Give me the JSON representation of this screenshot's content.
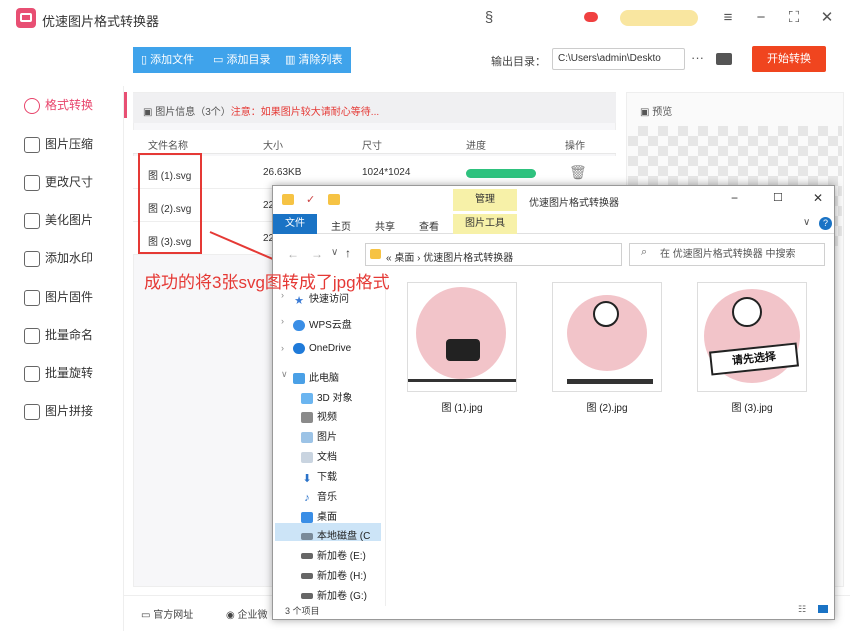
{
  "app": {
    "title": "优速图片格式转换器"
  },
  "toolbar": {
    "add_file": "添加文件",
    "add_dir": "添加目录",
    "clear_list": "清除列表",
    "output_label": "输出目录：",
    "output_path": "C:\\Users\\admin\\Deskto",
    "more": "···",
    "start": "开始转换"
  },
  "sidebar": {
    "items": [
      {
        "label": "格式转换"
      },
      {
        "label": "图片压缩"
      },
      {
        "label": "更改尺寸"
      },
      {
        "label": "美化图片"
      },
      {
        "label": "添加水印"
      },
      {
        "label": "图片固件"
      },
      {
        "label": "批量命名"
      },
      {
        "label": "批量旋转"
      },
      {
        "label": "图片拼接"
      }
    ]
  },
  "list": {
    "info": "图片信息（3个）",
    "note": "注意：如果图片较大请耐心等待...",
    "columns": [
      "文件名称",
      "大小",
      "尺寸",
      "进度",
      "操作"
    ],
    "rows": [
      {
        "name": "图 (1).svg",
        "size": "26.63KB",
        "dim": "1024*1024",
        "progress": 1.0
      },
      {
        "name": "图 (2).svg",
        "size": "22",
        "dim": "",
        "progress": null
      },
      {
        "name": "图 (3).svg",
        "size": "22",
        "dim": "",
        "progress": null
      }
    ]
  },
  "preview": {
    "label": "预览"
  },
  "footer": {
    "website": "官方网址",
    "enterprise": "企业微"
  },
  "explorer": {
    "title": "优速图片格式转换器",
    "manage": "管理",
    "picture_tools": "图片工具",
    "tabs": [
      "文件",
      "主页",
      "共享",
      "查看"
    ],
    "address": "« 桌面 › 优速图片格式转换器",
    "search_placeholder": "在 优速图片格式转换器 中搜索",
    "nav": [
      {
        "label": "快速访问"
      },
      {
        "label": "WPS云盘"
      },
      {
        "label": "OneDrive"
      },
      {
        "label": "此电脑"
      },
      {
        "label": "3D 对象"
      },
      {
        "label": "视频"
      },
      {
        "label": "图片"
      },
      {
        "label": "文档"
      },
      {
        "label": "下载"
      },
      {
        "label": "音乐"
      },
      {
        "label": "桌面"
      },
      {
        "label": "本地磁盘 (C"
      },
      {
        "label": "新加卷 (E:)"
      },
      {
        "label": "新加卷 (H:)"
      },
      {
        "label": "新加卷 (G:)"
      }
    ],
    "files": [
      {
        "name": "图 (1).jpg"
      },
      {
        "name": "图 (2).jpg"
      },
      {
        "name": "图 (3).jpg",
        "badge": "请先选择"
      }
    ],
    "status": "3 个项目"
  },
  "caption": "成功的将3张svg图转成了jpg格式",
  "colors": {
    "accent": "#e84f73",
    "blue": "#3fa3eb",
    "start": "#f0451f",
    "progress": "#2ec27e",
    "annotation": "#e53935"
  }
}
